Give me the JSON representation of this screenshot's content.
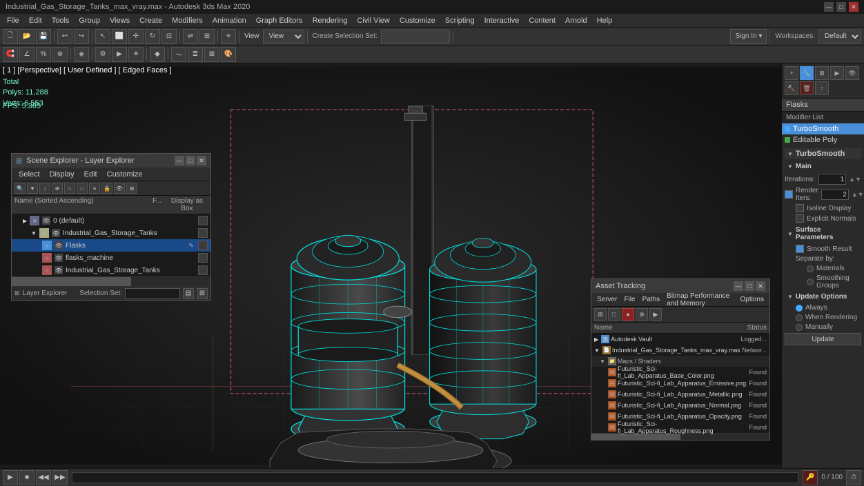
{
  "titlebar": {
    "title": "Industrial_Gas_Storage_Tanks_max_vray.max - Autodesk 3ds Max 2020",
    "min": "—",
    "max": "□",
    "close": "✕"
  },
  "menubar": {
    "items": [
      "File",
      "Edit",
      "Tools",
      "Group",
      "Views",
      "Create",
      "Modifiers",
      "Animation",
      "Graph Editors",
      "Rendering",
      "Civil View",
      "Customize",
      "Scripting",
      "Interactive",
      "Content",
      "Arnold",
      "Help"
    ]
  },
  "toolbar1": {
    "undo": "↩",
    "redo": "↪",
    "view_label": "View",
    "create_selection": "Create Selection Set:",
    "workspaces": "Workspaces:",
    "workspace_val": "Default",
    "sign_in": "Sign In"
  },
  "viewport": {
    "label": "[ 1 ] [Perspective] [ User Defined ] [ Edged Faces ]",
    "stats_total": "Total",
    "stats_polys": "Polys: 11,288",
    "stats_verts": "Verts: 6,553",
    "fps": "FPS: 5.365"
  },
  "right_panel": {
    "object_name": "Flasks",
    "modifier_list_label": "Modifier List",
    "modifiers": [
      {
        "name": "TurboSmooth",
        "active": true
      },
      {
        "name": "Editable Poly",
        "active": false
      }
    ],
    "turbosmooth": {
      "title": "TurboSmooth",
      "main_label": "Main",
      "iterations_label": "Iterations:",
      "iterations_value": "1",
      "render_items_label": "Render Iters:",
      "render_items_value": "2",
      "isoline_label": "Isoline Display",
      "explicit_normals_label": "Explicit Normals",
      "surface_params_label": "Surface Parameters",
      "smooth_result_label": "Smooth Result",
      "separate_by_label": "Separate by:",
      "materials_label": "Materials",
      "smoothing_groups_label": "Smoothing Groups",
      "update_options_label": "Update Options",
      "always_label": "Always",
      "when_rendering_label": "When Rendering",
      "manually_label": "Manually",
      "update_label": "Update"
    }
  },
  "scene_explorer": {
    "title": "Scene Explorer - Layer Explorer",
    "menus": [
      "Select",
      "Display",
      "Edit",
      "Customize"
    ],
    "columns": {
      "name": "Name (Sorted Ascending)",
      "f": "F...",
      "display_as_box": "Display as Box"
    },
    "rows": [
      {
        "indent": 1,
        "name": "0 (default)",
        "type": "layer",
        "sel": false
      },
      {
        "indent": 2,
        "name": "Industrial_Gas_Storage_Tanks",
        "type": "object",
        "sel": false
      },
      {
        "indent": 3,
        "name": "Flasks",
        "type": "object",
        "sel": true
      },
      {
        "indent": 3,
        "name": "flasks_machine",
        "type": "object",
        "sel": false
      },
      {
        "indent": 3,
        "name": "Industrial_Gas_Storage_Tanks",
        "type": "object",
        "sel": false
      }
    ],
    "footer": {
      "layer_explorer": "Layer Explorer",
      "selection_set_label": "Selection Set:"
    }
  },
  "asset_tracking": {
    "title": "Asset Tracking",
    "menus": [
      "Server",
      "File",
      "Paths",
      "Bitmap Performance and Memory",
      "Options"
    ],
    "columns": {
      "name": "Name",
      "status": "Status"
    },
    "rows": [
      {
        "indent": 0,
        "name": "Autodesk Vault",
        "status": "Logged...",
        "type": "vault"
      },
      {
        "indent": 0,
        "name": "Industrial_Gas_Storage_Tanks_max_vray.max",
        "status": "Networ...",
        "type": "file"
      },
      {
        "indent": 1,
        "name": "Maps / Shaders",
        "status": "",
        "type": "group"
      },
      {
        "indent": 2,
        "name": "Futuristic_Sci-fi_Lab_Apparatus_Base_Color.png",
        "status": "Found",
        "type": "img"
      },
      {
        "indent": 2,
        "name": "Futuristic_Sci-fi_Lab_Apparatus_Emissive.png",
        "status": "Found",
        "type": "img"
      },
      {
        "indent": 2,
        "name": "Futuristic_Sci-fi_Lab_Apparatus_Metallic.png",
        "status": "Found",
        "type": "img"
      },
      {
        "indent": 2,
        "name": "Futuristic_Sci-fi_Lab_Apparatus_Normal.png",
        "status": "Found",
        "type": "img"
      },
      {
        "indent": 2,
        "name": "Futuristic_Sci-fi_Lab_Apparatus_Opacity.png",
        "status": "Found",
        "type": "img"
      },
      {
        "indent": 2,
        "name": "Futuristic_Sci-fi_Lab_Apparatus_Roughness.png",
        "status": "Found",
        "type": "img"
      }
    ]
  },
  "icons": {
    "triangle": "▶",
    "eye": "👁",
    "folder": "📁",
    "layer": "≡",
    "object": "○",
    "lock": "🔒",
    "image": "🖼",
    "search": "🔍",
    "gear": "⚙",
    "plus": "+",
    "minus": "−",
    "close": "✕",
    "minimize": "—",
    "restore": "□",
    "arrow_down": "▼",
    "arrow_right": "▶",
    "check": "✓"
  }
}
